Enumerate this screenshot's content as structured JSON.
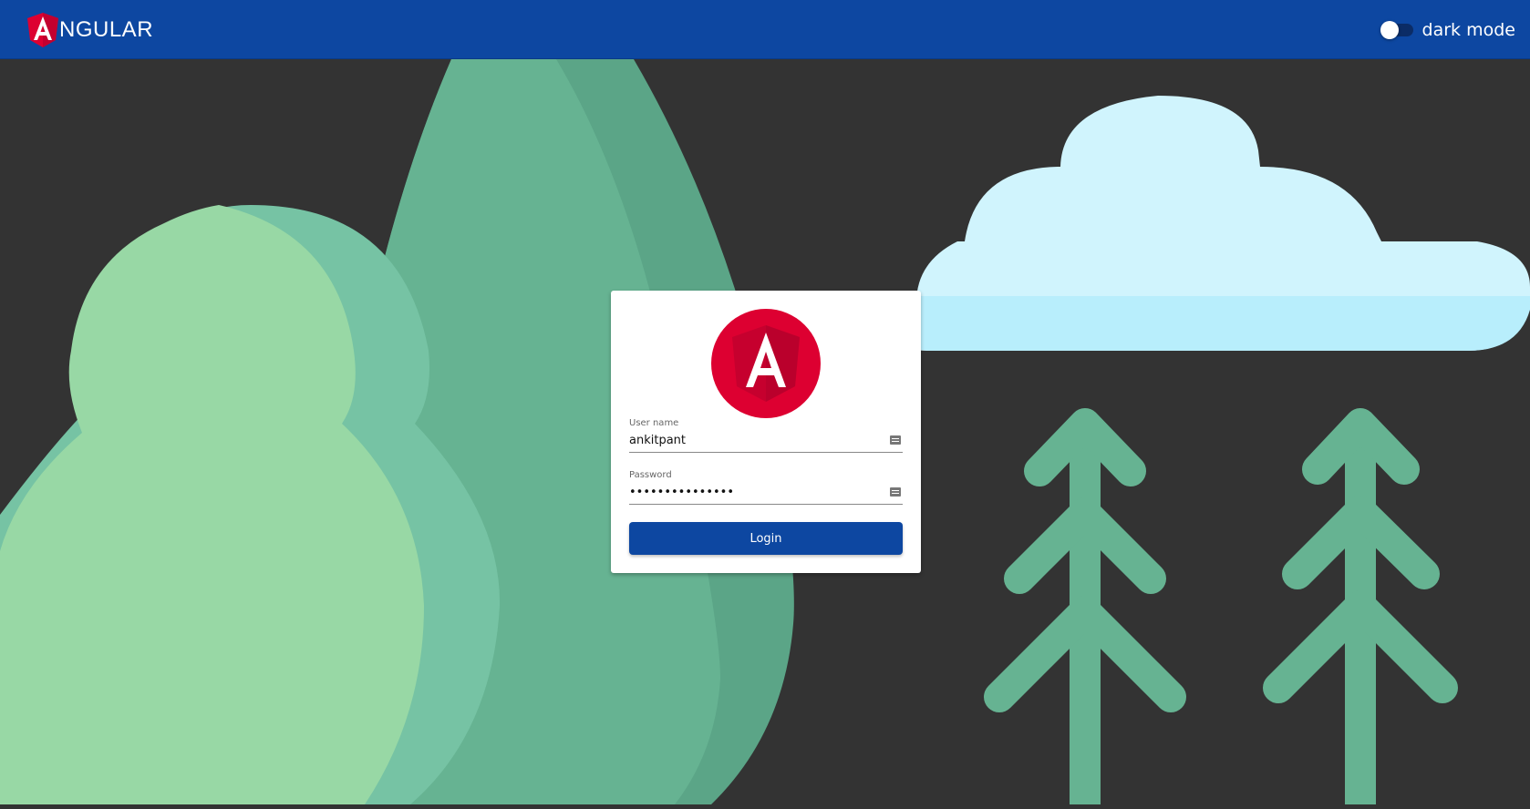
{
  "toolbar": {
    "brand_text": "NGULAR",
    "brand_icon": "angular-logo-icon",
    "dark_mode_label": "dark mode",
    "dark_mode_enabled": false
  },
  "login": {
    "logo_icon": "angular-logo-icon",
    "username_label": "User name",
    "username_value": "ankitpant",
    "password_label": "Password",
    "password_value": "•••••••••••••••",
    "login_button": "Login"
  },
  "colors": {
    "toolbar": "#0d47a1",
    "background": "#333333",
    "angular_red": "#dd0031",
    "tree_light": "#98d8a5",
    "tree_mid": "#76c3a4",
    "tree_dark": "#66b392",
    "cloud": "#d0f4fd"
  }
}
